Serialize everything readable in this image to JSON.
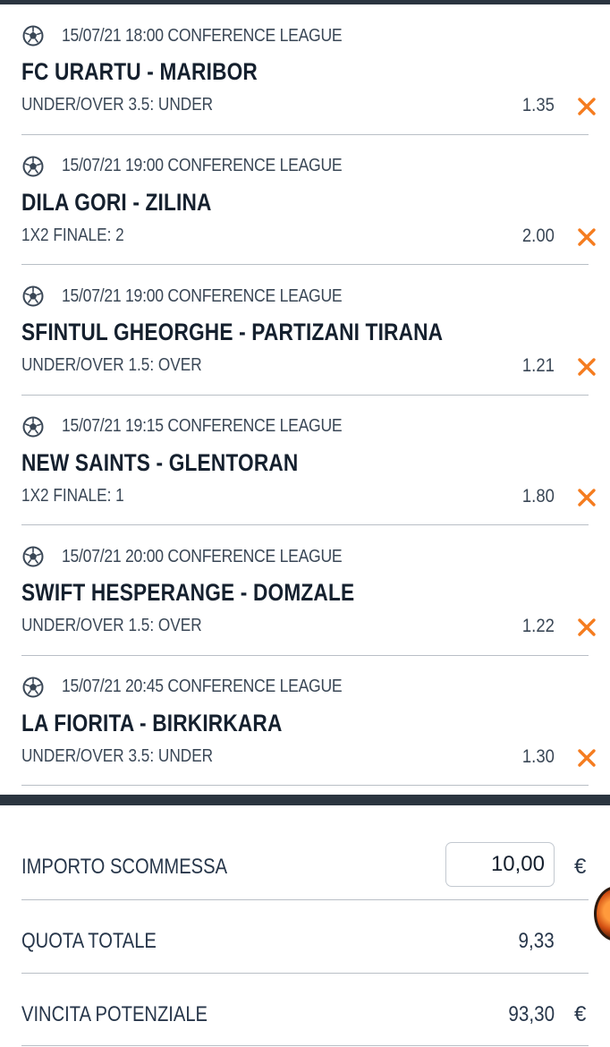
{
  "bets": [
    {
      "datetime": "15/07/21 18:00 CONFERENCE LEAGUE",
      "match": "FC URARTU - MARIBOR",
      "pick": "UNDER/OVER 3.5: UNDER",
      "odd": "1.35"
    },
    {
      "datetime": "15/07/21 19:00 CONFERENCE LEAGUE",
      "match": "DILA GORI - ZILINA",
      "pick": "1X2 FINALE: 2",
      "odd": "2.00"
    },
    {
      "datetime": "15/07/21 19:00 CONFERENCE LEAGUE",
      "match": "SFINTUL GHEORGHE - PARTIZANI TIRANA",
      "pick": "UNDER/OVER 1.5: OVER",
      "odd": "1.21"
    },
    {
      "datetime": "15/07/21 19:15 CONFERENCE LEAGUE",
      "match": "NEW SAINTS - GLENTORAN",
      "pick": "1X2 FINALE: 1",
      "odd": "1.80"
    },
    {
      "datetime": "15/07/21 20:00 CONFERENCE LEAGUE",
      "match": "SWIFT HESPERANGE - DOMZALE",
      "pick": "UNDER/OVER 1.5: OVER",
      "odd": "1.22"
    },
    {
      "datetime": "15/07/21 20:45 CONFERENCE LEAGUE",
      "match": "LA FIORITA - BIRKIRKARA",
      "pick": "UNDER/OVER 3.5: UNDER",
      "odd": "1.30"
    }
  ],
  "summary": {
    "stake_label": "IMPORTO SCOMMESSA",
    "stake_value": "10,00",
    "currency": "€",
    "total_odds_label": "QUOTA TOTALE",
    "total_odds_value": "9,33",
    "potential_win_label": "VINCITA POTENZIALE",
    "potential_win_value": "93,30"
  },
  "icons": {
    "sport": "soccer-ball-icon",
    "remove": "remove-x-icon"
  },
  "colors": {
    "accent": "#f57c1f",
    "dark_bar": "#2b3540",
    "text": "#1f2b3b"
  }
}
